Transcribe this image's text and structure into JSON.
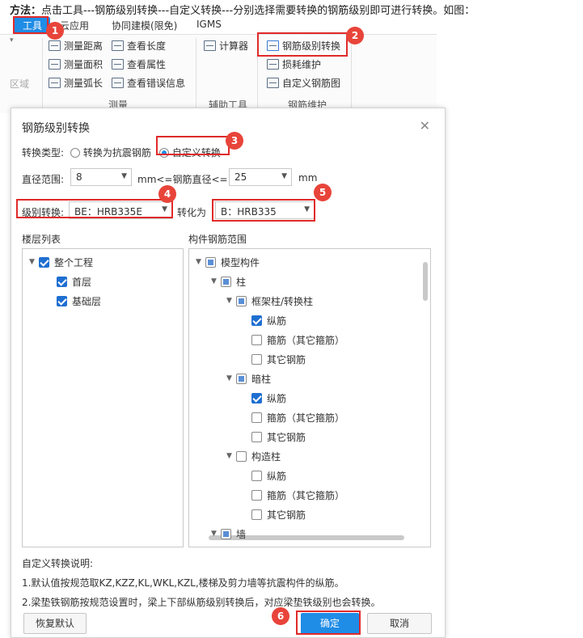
{
  "instruction": {
    "prefix": "方法：",
    "text": "点击工具---钢筋级别转换---自定义转换---分别选择需要转换的钢筋级别即可进行转换。如图："
  },
  "ribbon": {
    "tabs": [
      "工具",
      "云应用",
      "协同建模(限免)",
      "IGMS"
    ],
    "left_stub_label": "区域",
    "measure_group": {
      "label": "测量",
      "items": [
        "测量距离",
        "测量面积",
        "测量弧长"
      ],
      "items2": [
        "查看长度",
        "查看属性",
        "查看错误信息"
      ]
    },
    "aux_group": {
      "label": "辅助工具",
      "items": [
        "计算器"
      ]
    },
    "rebar_group": {
      "label": "钢筋维护",
      "items": [
        "钢筋级别转换",
        "损耗维护",
        "自定义钢筋图"
      ]
    }
  },
  "badges": [
    "1",
    "2",
    "3",
    "4",
    "5",
    "6"
  ],
  "dialog": {
    "title": "钢筋级别转换",
    "close_glyph": "✕",
    "type_label": "转换类型:",
    "type_options": [
      "转换为抗震钢筋",
      "自定义转换"
    ],
    "selected_type": "自定义转换",
    "diameter_label": "直径范围:",
    "diameter_min": "8",
    "diameter_mid": "mm<=钢筋直径<=",
    "diameter_max": "25",
    "diameter_unit": "mm",
    "grade_label": "级别转换:",
    "grade_from": "BE：HRB335E",
    "convert_to_label": "转化为",
    "grade_to": "B：HRB335",
    "floor_list_label": "楼层列表",
    "component_range_label": "构件钢筋范围",
    "floor_tree": [
      {
        "label": "整个工程",
        "checked": true,
        "level": 0,
        "expander": "▼"
      },
      {
        "label": "首层",
        "checked": true,
        "level": 1
      },
      {
        "label": "基础层",
        "checked": true,
        "level": 1
      }
    ],
    "component_tree": [
      {
        "label": "模型构件",
        "state": "partial",
        "level": 0,
        "expander": "▼"
      },
      {
        "label": "柱",
        "state": "partial",
        "level": 1,
        "expander": "▼"
      },
      {
        "label": "框架柱/转换柱",
        "state": "partial",
        "level": 2,
        "expander": "▼"
      },
      {
        "label": "纵筋",
        "state": "checked",
        "level": 3
      },
      {
        "label": "箍筋（其它箍筋）",
        "state": "unchecked",
        "level": 3
      },
      {
        "label": "其它钢筋",
        "state": "unchecked",
        "level": 3
      },
      {
        "label": "暗柱",
        "state": "partial",
        "level": 2,
        "expander": "▼"
      },
      {
        "label": "纵筋",
        "state": "checked",
        "level": 3
      },
      {
        "label": "箍筋（其它箍筋）",
        "state": "unchecked",
        "level": 3
      },
      {
        "label": "其它钢筋",
        "state": "unchecked",
        "level": 3
      },
      {
        "label": "构造柱",
        "state": "unchecked",
        "level": 2,
        "expander": "▼"
      },
      {
        "label": "纵筋",
        "state": "unchecked",
        "level": 3
      },
      {
        "label": "箍筋（其它箍筋）",
        "state": "unchecked",
        "level": 3
      },
      {
        "label": "其它钢筋",
        "state": "unchecked",
        "level": 3
      },
      {
        "label": "墙",
        "state": "partial",
        "level": 1,
        "expander": "▼"
      }
    ],
    "notes_title": "自定义转换说明:",
    "notes": [
      "1.默认值按规范取KZ,KZZ,KL,WKL,KZL,楼梯及剪力墙等抗震构件的纵筋。",
      "2.梁垫铁钢筋按规范设置时，梁上下部纵筋级别转换后，对应梁垫铁级别也会转换。"
    ],
    "reset_button": "恢复默认",
    "ok_button": "确定",
    "cancel_button": "取消"
  },
  "colors": {
    "accent": "#1f8ce6",
    "highlight": "#e02a2a",
    "badge": "#e8443a"
  }
}
